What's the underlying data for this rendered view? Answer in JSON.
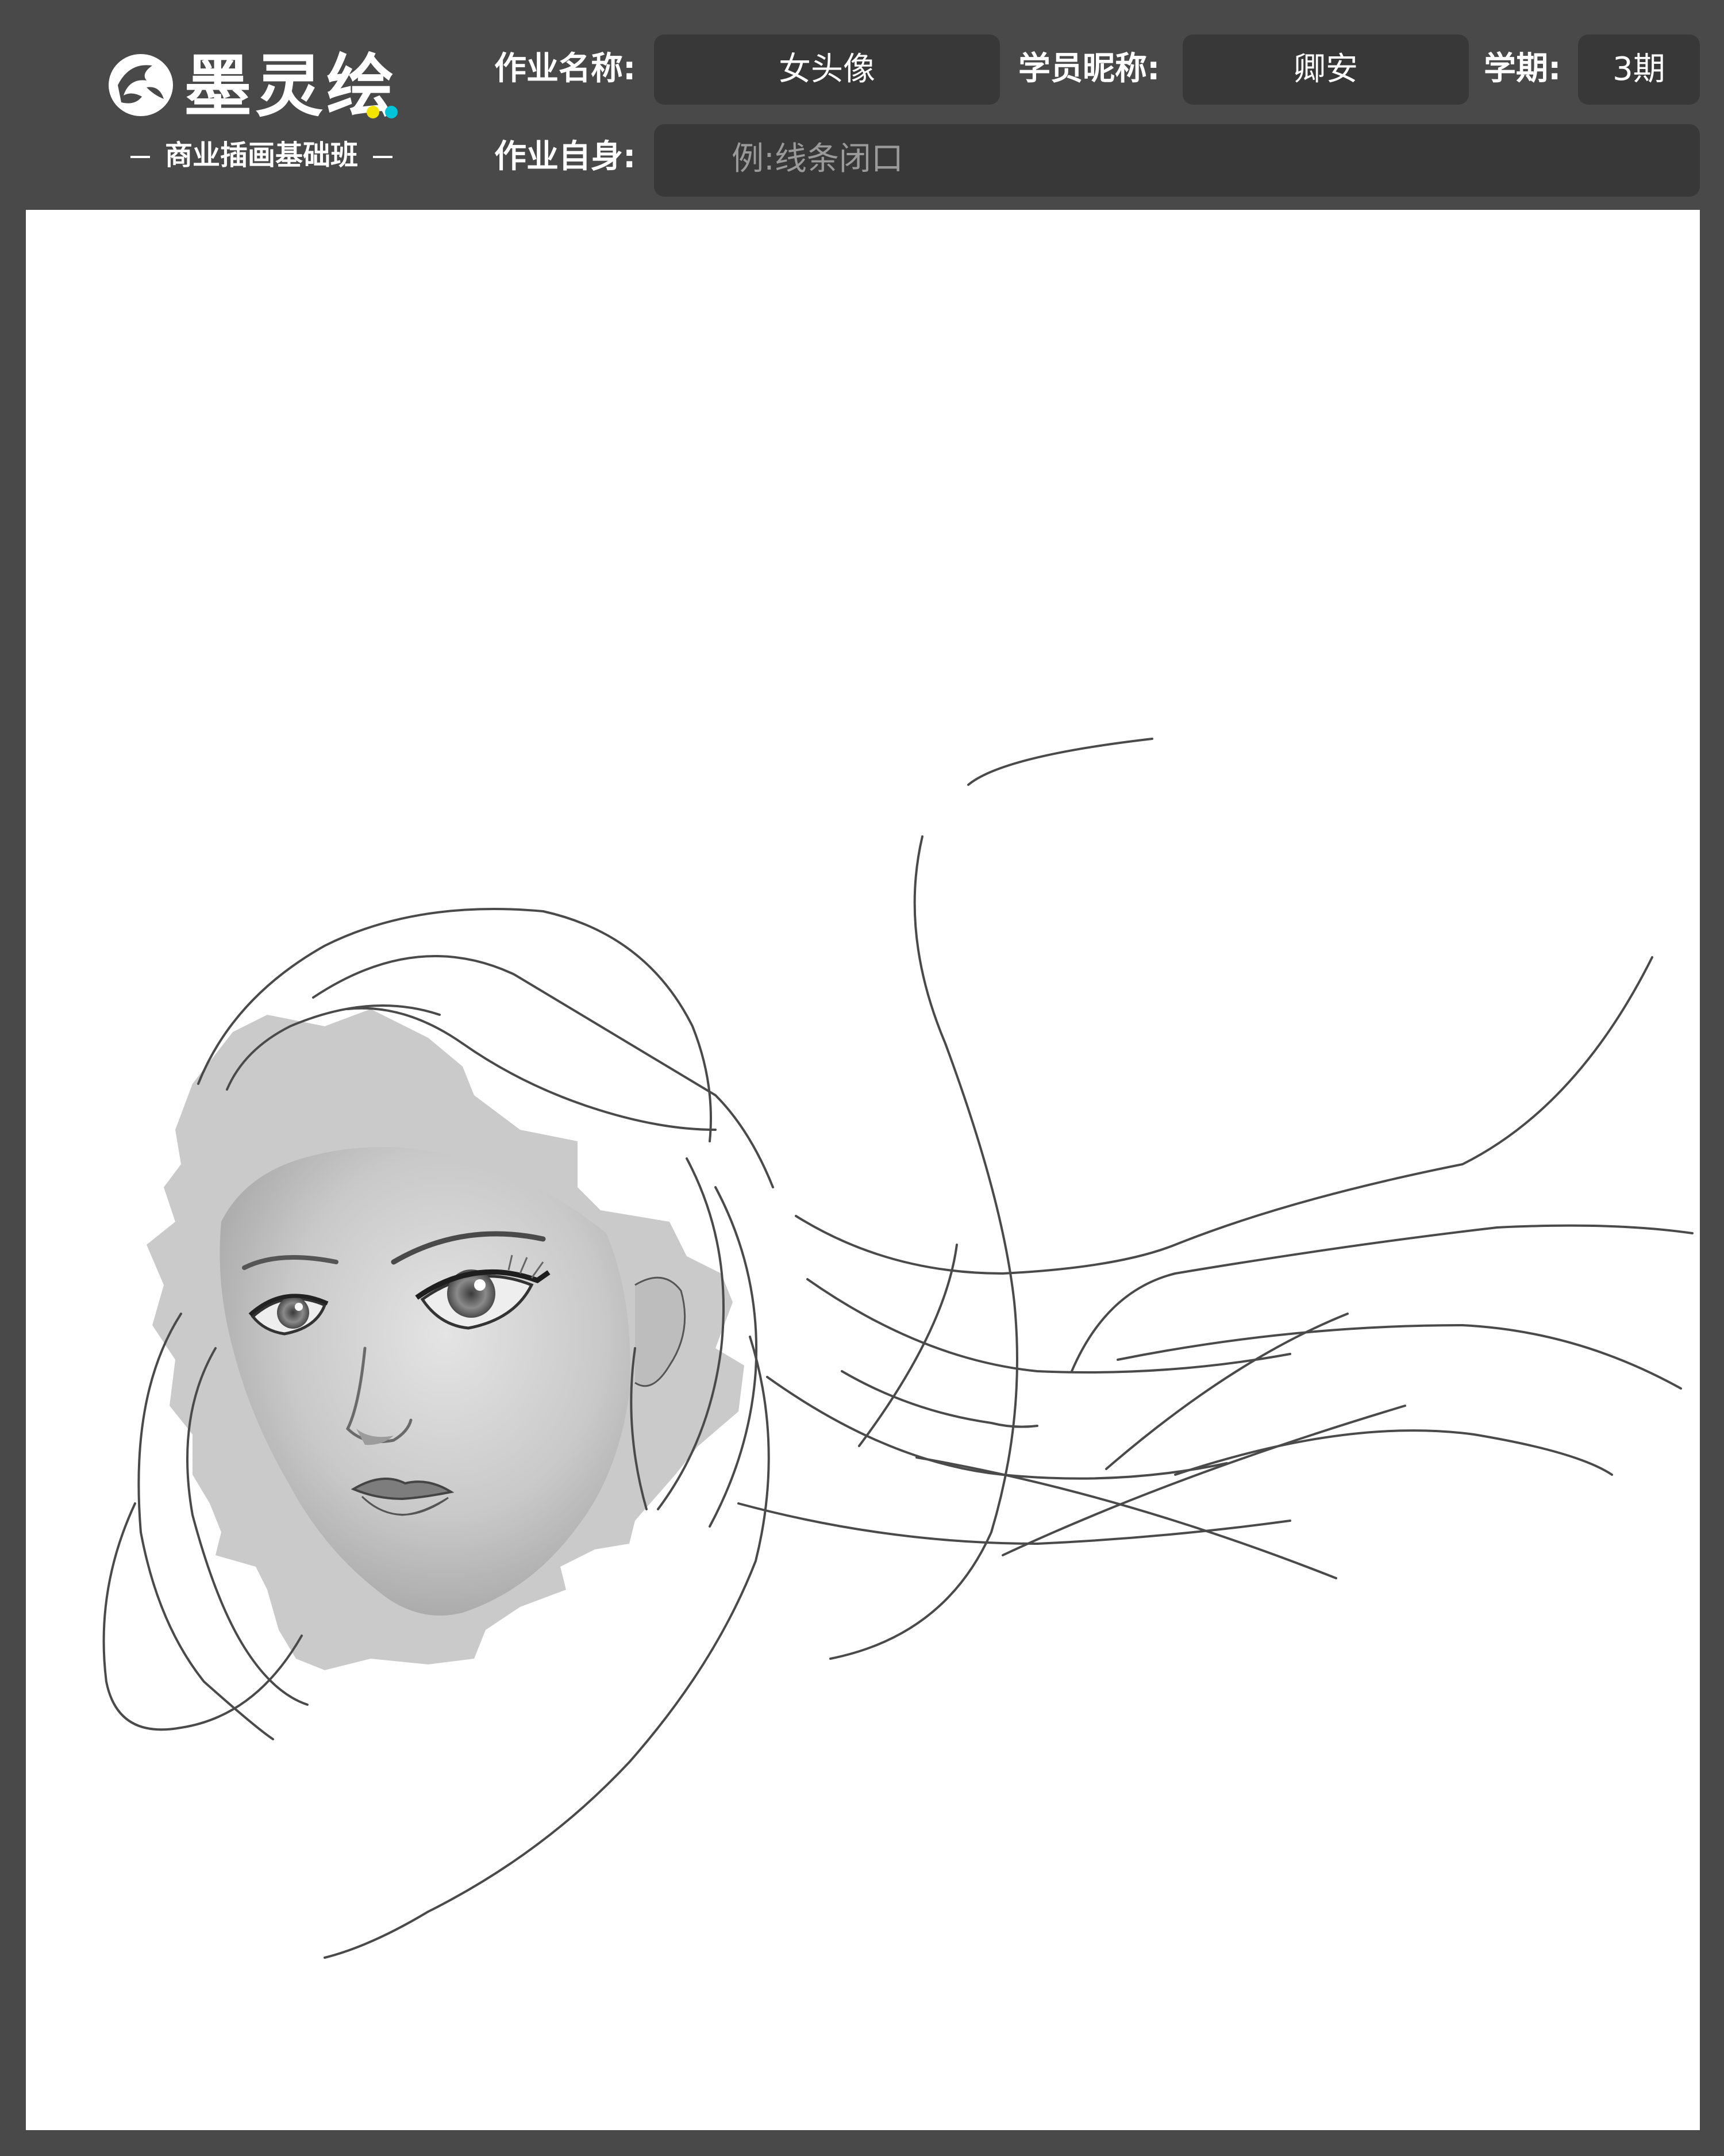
{
  "brand": {
    "name": "墨灵绘",
    "subtitle": "商业插画基础班",
    "logo_icon": "ink-drop-face-icon",
    "accent_colors": [
      "#f2e300",
      "#00c4d8"
    ]
  },
  "form": {
    "homework_name": {
      "label": "作业名称:",
      "value": "女头像"
    },
    "student_nickname": {
      "label": "学员昵称:",
      "value": "卿安"
    },
    "term": {
      "label": "学期:",
      "value": "3期"
    },
    "homework_self": {
      "label": "作业自身:",
      "placeholder": "例:线条闭口"
    }
  },
  "colors": {
    "frame": "#494949",
    "field": "#383838",
    "canvas": "#ffffff",
    "skin_block": "#c8c8c8"
  },
  "artwork": {
    "subject": "female-portrait-sketch-icon"
  }
}
